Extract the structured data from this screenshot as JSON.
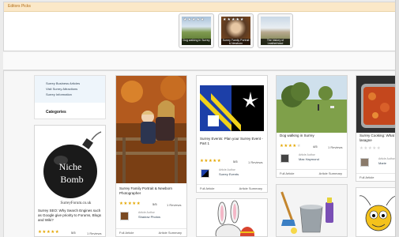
{
  "editors": {
    "title": "Editors Picks",
    "picks": [
      {
        "caption": "Dog walking in Surrey",
        "stars": "★★★★★"
      },
      {
        "caption": "Surrey Family Portrait & Newborn Photographer",
        "stars": "★★★★★"
      },
      {
        "caption": "The history of Leatherhead",
        "stars": ""
      }
    ]
  },
  "sidebar": {
    "links": [
      "Surrey Business Articles",
      "Visit Surrey Attractions",
      "Surrey Information"
    ],
    "categories_label": "Categories"
  },
  "cards": {
    "niche": {
      "logo_line1": "Niche",
      "logo_line2": "Bomb",
      "source": "SurreyForum.co.uk",
      "title": "Surrey SEO: Why Search Engines such as Google give priority to Forums, Blogs and Wiki?",
      "score": "5/5",
      "reviews": "1 Reviews"
    },
    "family": {
      "title": "Surrey Family Portrait & Newborn Photographer",
      "score": "5/5",
      "reviews": "1 Reviews",
      "author_label": "Article Author",
      "author_name": "Shadow Photos",
      "full_article": "Full Article",
      "article_summary": "Article Summary"
    },
    "events": {
      "title": "Surrey Events: Plan your Surrey Event - Part 1",
      "score": "5/5",
      "reviews": "1 Reviews",
      "author_label": "Article Author",
      "author_name": "Surrey Events",
      "full_article": "Full Article",
      "article_summary": "Article Summary"
    },
    "dog": {
      "title": "Dog walking in Surrey",
      "score": "4/5",
      "reviews": "1 Reviews",
      "author_label": "Article Author",
      "author_name": "Max Haymond",
      "full_article": "Full Article",
      "article_summary": "Article Summary"
    },
    "cooking": {
      "title": "Surrey Cooking: What lasagne",
      "author_label": "Article Author",
      "author_name": "Marie",
      "full_article": "Full Article"
    }
  },
  "colors": {
    "header_bg": "#fbe8c8",
    "header_text": "#b06a14",
    "star": "#e4a600"
  }
}
